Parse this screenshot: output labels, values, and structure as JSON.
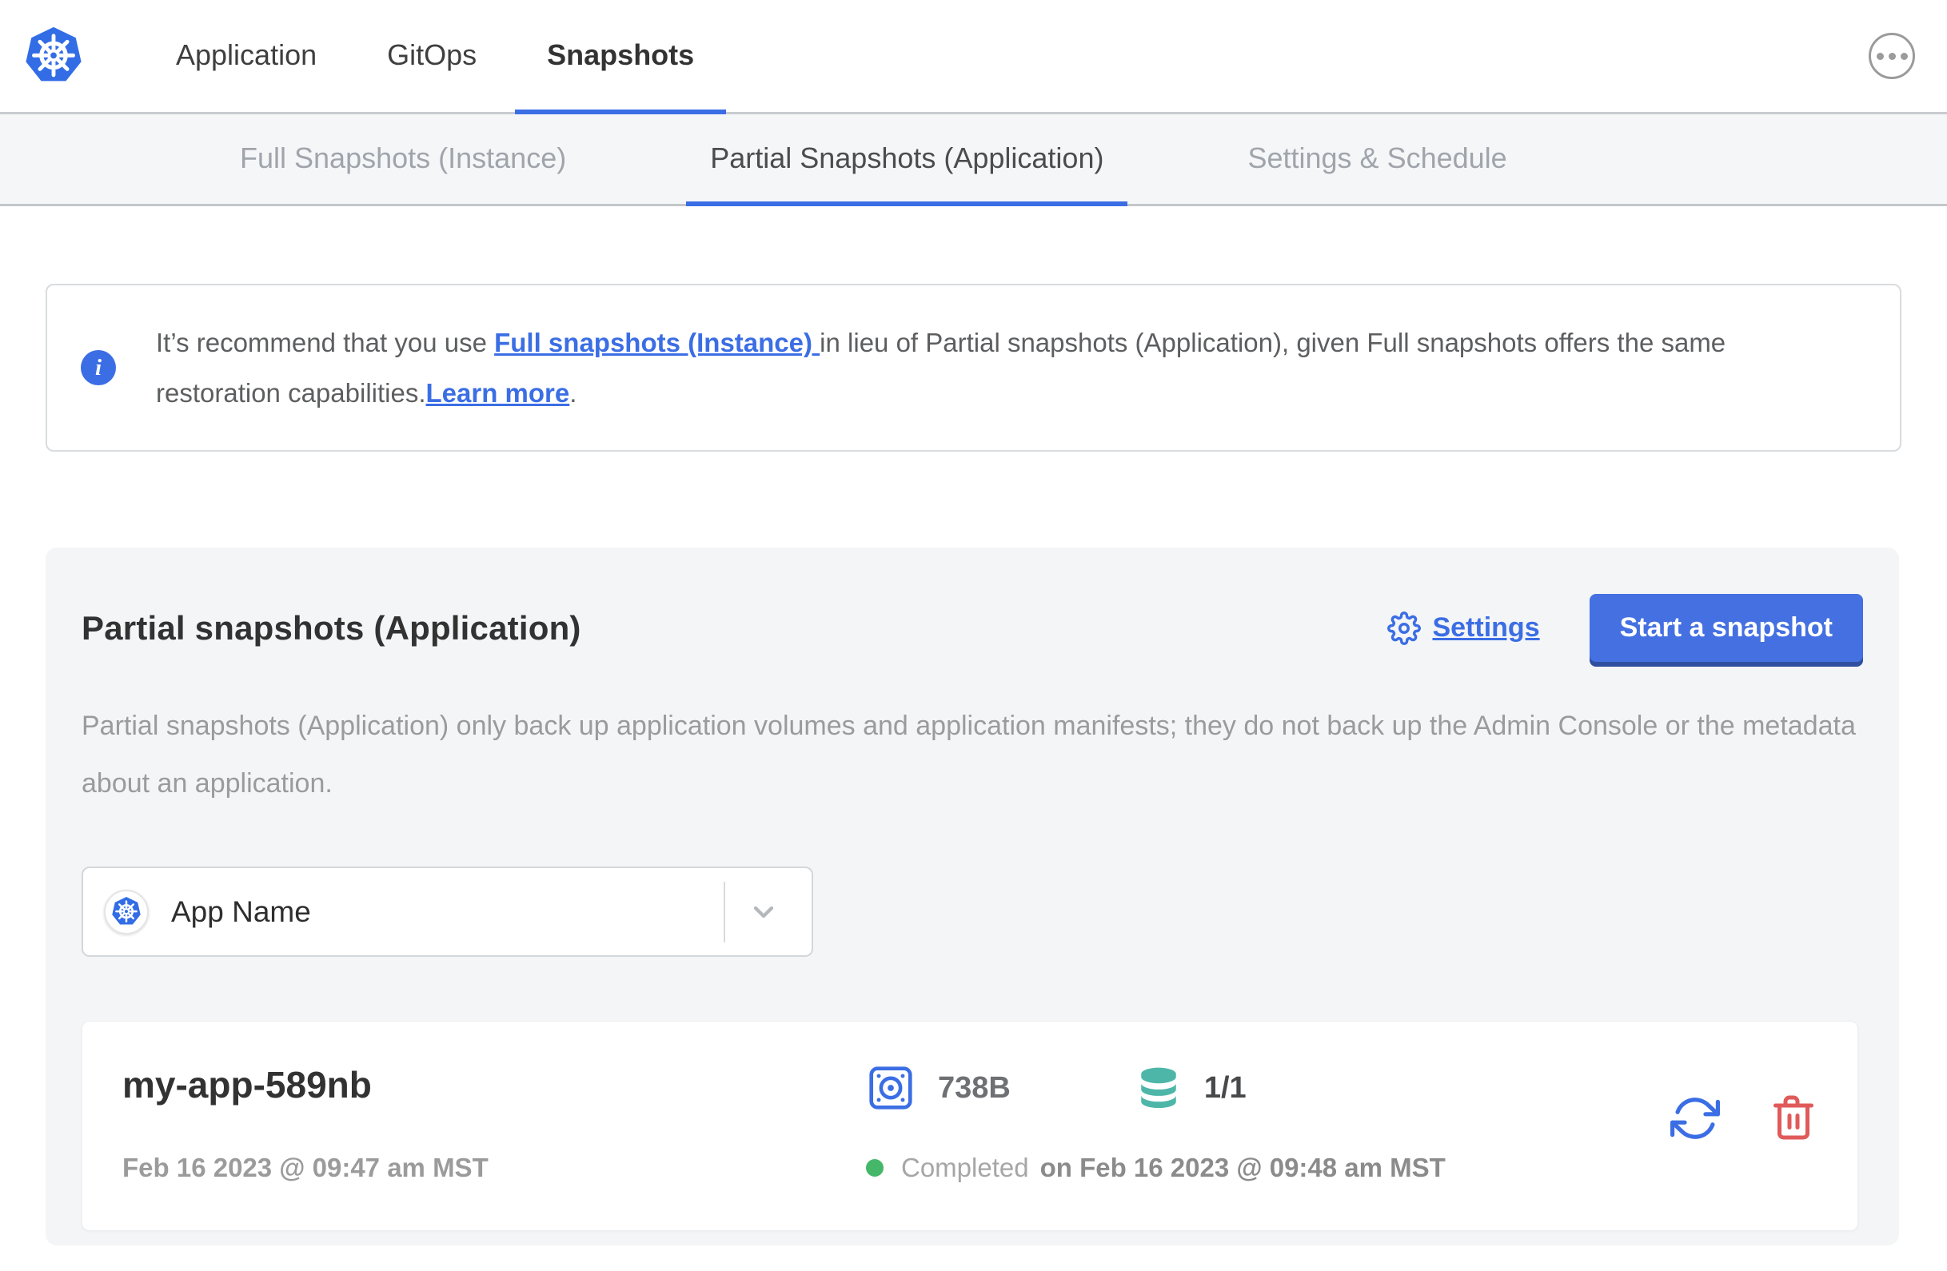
{
  "header": {
    "nav": [
      {
        "label": "Application",
        "active": false
      },
      {
        "label": "GitOps",
        "active": false
      },
      {
        "label": "Snapshots",
        "active": true
      }
    ]
  },
  "subnav": {
    "tabs": [
      {
        "label": "Full Snapshots (Instance)",
        "active": false
      },
      {
        "label": "Partial Snapshots (Application)",
        "active": true
      },
      {
        "label": "Settings & Schedule",
        "active": false
      }
    ]
  },
  "banner": {
    "part1": "It’s recommend that you use ",
    "link_full_snapshots": "Full snapshots (Instance) ",
    "part2": "in lieu of Partial snapshots (Application), given Full snapshots offers the same restoration capabilities.",
    "link_learn_more": "Learn more",
    "part3": "."
  },
  "main": {
    "title": "Partial snapshots (Application)",
    "settings_label": "Settings",
    "start_button_label": "Start a snapshot",
    "description": "Partial snapshots (Application) only back up application volumes and application manifests; they do not back up the Admin Console or the metadata about an application.",
    "app_selector": {
      "value": "App Name"
    },
    "snapshots": [
      {
        "name": "my-app-589nb",
        "started": "Feb 16 2023 @ 09:47 am MST",
        "size": "738B",
        "volumes": "1/1",
        "status": "Completed",
        "finished": "on Feb 16 2023 @ 09:48 am MST"
      }
    ]
  },
  "icons": {
    "logo": "kubernetes-wheel",
    "menu": "ellipsis-circle",
    "banner": "info-circle",
    "settings": "gear",
    "selector_left": "kubernetes-wheel",
    "selector_right": "chevron-down",
    "snapshot_size": "disk",
    "snapshot_volumes": "database",
    "row_actions": [
      "restore",
      "trash"
    ]
  },
  "colors": {
    "accent_blue": "#3b6ee4",
    "button_blue": "#4470e2",
    "teal": "#4db6a9",
    "danger_red": "#e05a5a",
    "success_green": "#44b868",
    "card_gray": "#f4f5f7"
  }
}
